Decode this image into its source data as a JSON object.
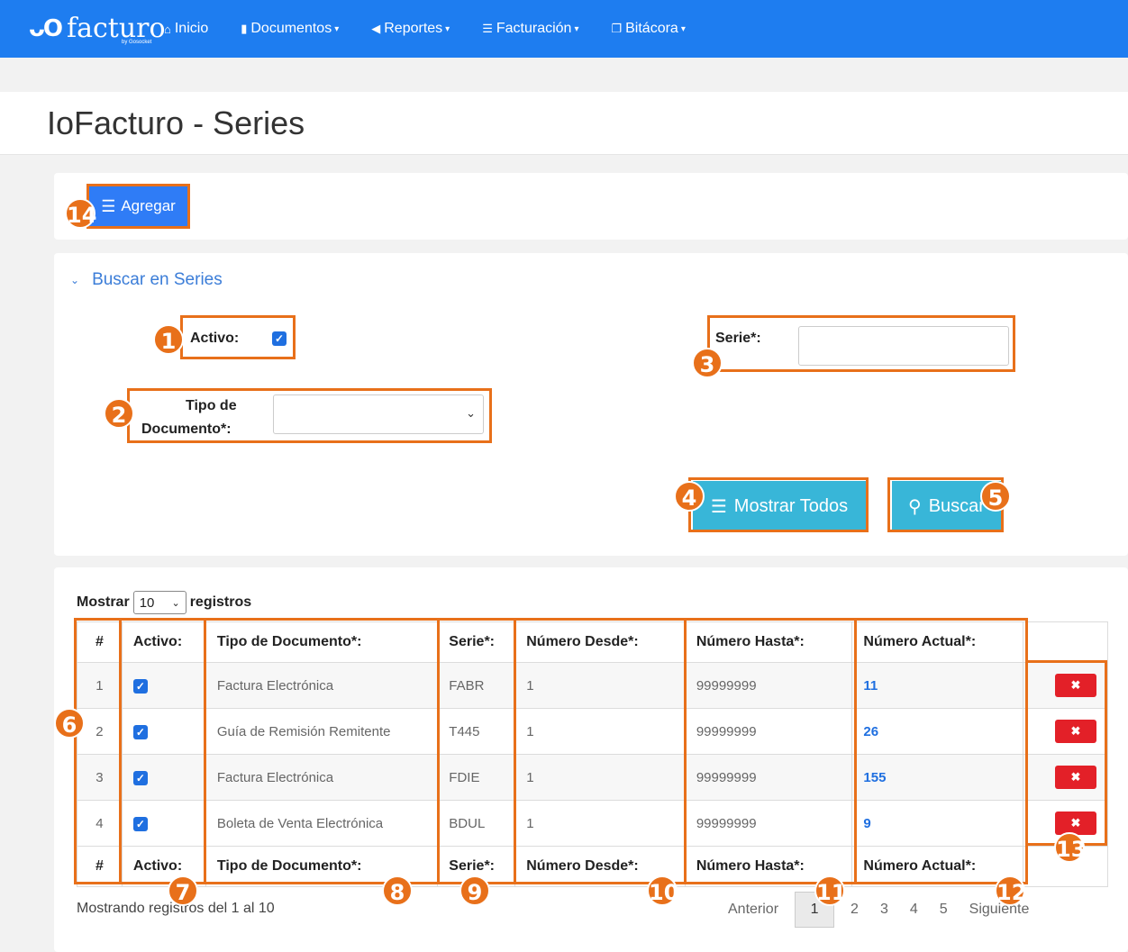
{
  "nav": {
    "logo_mark": "ᴗO",
    "logo_text": "facturo",
    "logo_sub": "by Gosocket",
    "items": [
      {
        "label": "Inicio",
        "icon": "home-icon",
        "glyph": "⌂",
        "caret": ""
      },
      {
        "label": "Documentos",
        "icon": "file-icon",
        "glyph": "▮",
        "caret": "▾"
      },
      {
        "label": "Reportes",
        "icon": "megaphone-icon",
        "glyph": "◀",
        "caret": "▾"
      },
      {
        "label": "Facturación",
        "icon": "list-icon",
        "glyph": "☰",
        "caret": "▾"
      },
      {
        "label": "Bitácora",
        "icon": "copy-icon",
        "glyph": "❐",
        "caret": "▾"
      }
    ]
  },
  "page": {
    "title": "IoFacturo - Series"
  },
  "toolbar": {
    "add_label": "Agregar"
  },
  "search": {
    "heading": "Buscar en Series",
    "activo_label": "Activo:",
    "tipo_label_1": "Tipo de",
    "tipo_label_2": "Documento*:",
    "serie_label": "Serie*:",
    "serie_value": "",
    "show_all_label": "Mostrar Todos",
    "search_label": "Buscar"
  },
  "table": {
    "length_prefix": "Mostrar",
    "length_value": "10",
    "length_suffix": "registros",
    "headers": [
      "#",
      "Activo:",
      "Tipo de Documento*:",
      "Serie*:",
      "Número Desde*:",
      "Número Hasta*:",
      "Número Actual*:",
      ""
    ],
    "rows": [
      {
        "num": "1",
        "tipo": "Factura Electrónica",
        "serie": "FABR",
        "desde": "1",
        "hasta": "99999999",
        "actual": "11"
      },
      {
        "num": "2",
        "tipo": "Guía de Remisión Remitente",
        "serie": "T445",
        "desde": "1",
        "hasta": "99999999",
        "actual": "26"
      },
      {
        "num": "3",
        "tipo": "Factura Electrónica",
        "serie": "FDIE",
        "desde": "1",
        "hasta": "99999999",
        "actual": "155"
      },
      {
        "num": "4",
        "tipo": "Boleta de Venta Electrónica",
        "serie": "BDUL",
        "desde": "1",
        "hasta": "99999999",
        "actual": "9"
      }
    ],
    "info": "Mostrando registros del 1 al 10",
    "pager": {
      "prev": "Anterior",
      "pages": [
        "1",
        "2",
        "3",
        "4",
        "5"
      ],
      "next": "Siguiente"
    }
  },
  "annotations": [
    "1",
    "2",
    "3",
    "4",
    "5",
    "6",
    "7",
    "8",
    "9",
    "10",
    "11",
    "12",
    "13",
    "14"
  ],
  "colors": {
    "navbar": "#1e7df0",
    "primary": "#2f7cf6",
    "cyan": "#38b6d8",
    "danger": "#e32028",
    "annotation": "#e8701a"
  }
}
